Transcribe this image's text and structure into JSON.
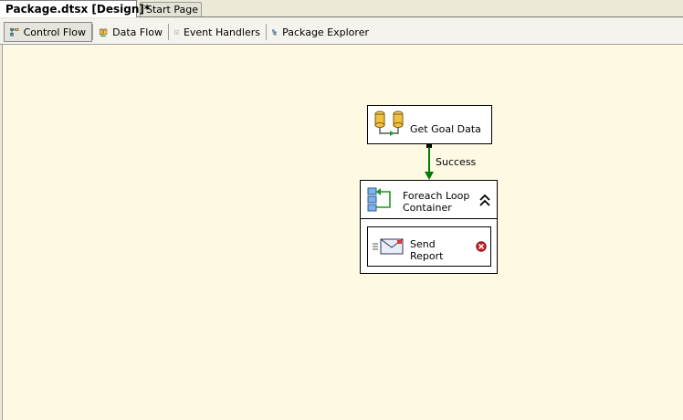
{
  "doc_tabs": {
    "active": "Package.dtsx [Design]*",
    "inactive": "Start Page"
  },
  "designer_tabs": [
    {
      "label": "Control Flow",
      "icon": "control-flow-icon"
    },
    {
      "label": "Data Flow",
      "icon": "data-flow-icon"
    },
    {
      "label": "Event Handlers",
      "icon": "event-handlers-icon"
    },
    {
      "label": "Package Explorer",
      "icon": "package-explorer-icon"
    }
  ],
  "canvas": {
    "tasks": {
      "get_goal": {
        "label": "Get Goal Data",
        "icon": "data-flow-task-icon"
      },
      "foreach": {
        "label": "Foreach Loop Container",
        "line1": "Foreach Loop",
        "line2": "Container",
        "icon": "foreach-loop-icon",
        "collapse": "collapse-icon"
      },
      "send_report": {
        "label": "Send Report",
        "line1": "Send",
        "line2": "Report",
        "icon": "send-mail-icon",
        "status": "error-icon"
      }
    },
    "connector": {
      "label": "Success",
      "color": "#007a00"
    }
  },
  "colors": {
    "canvas_bg": "#fdf9e3",
    "error": "#cc2222"
  }
}
